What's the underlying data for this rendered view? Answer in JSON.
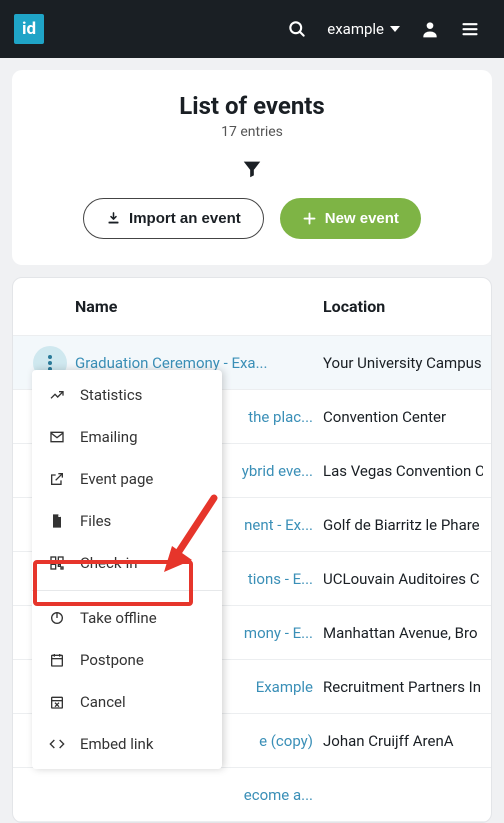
{
  "header": {
    "logo_text": "id",
    "account_label": "example"
  },
  "list_card": {
    "title": "List of events",
    "entries_text": "17 entries",
    "import_label": "Import an event",
    "new_label": "New event"
  },
  "table": {
    "col_name": "Name",
    "col_location": "Location",
    "rows": [
      {
        "name": "Graduation Ceremony - Exa...",
        "location": "Your University Campus"
      },
      {
        "name": "the plac...",
        "location": "Convention Center"
      },
      {
        "name": "ybrid eve...",
        "location": "Las Vegas Convention C"
      },
      {
        "name": "nent - Ex...",
        "location": "Golf de Biarritz le Phare"
      },
      {
        "name": "tions - E...",
        "location": "UCLouvain Auditoires C"
      },
      {
        "name": "mony - E...",
        "location": "Manhattan Avenue, Bro"
      },
      {
        "name": "Example",
        "location": "Recruitment Partners In"
      },
      {
        "name": "e (copy)",
        "location": "Johan Cruijff ArenA"
      },
      {
        "name": "ecome a...",
        "location": ""
      }
    ]
  },
  "ctx": {
    "statistics": "Statistics",
    "emailing": "Emailing",
    "event_page": "Event page",
    "files": "Files",
    "check_in": "Check-in",
    "take_offline": "Take offline",
    "postpone": "Postpone",
    "cancel": "Cancel",
    "embed": "Embed link"
  }
}
